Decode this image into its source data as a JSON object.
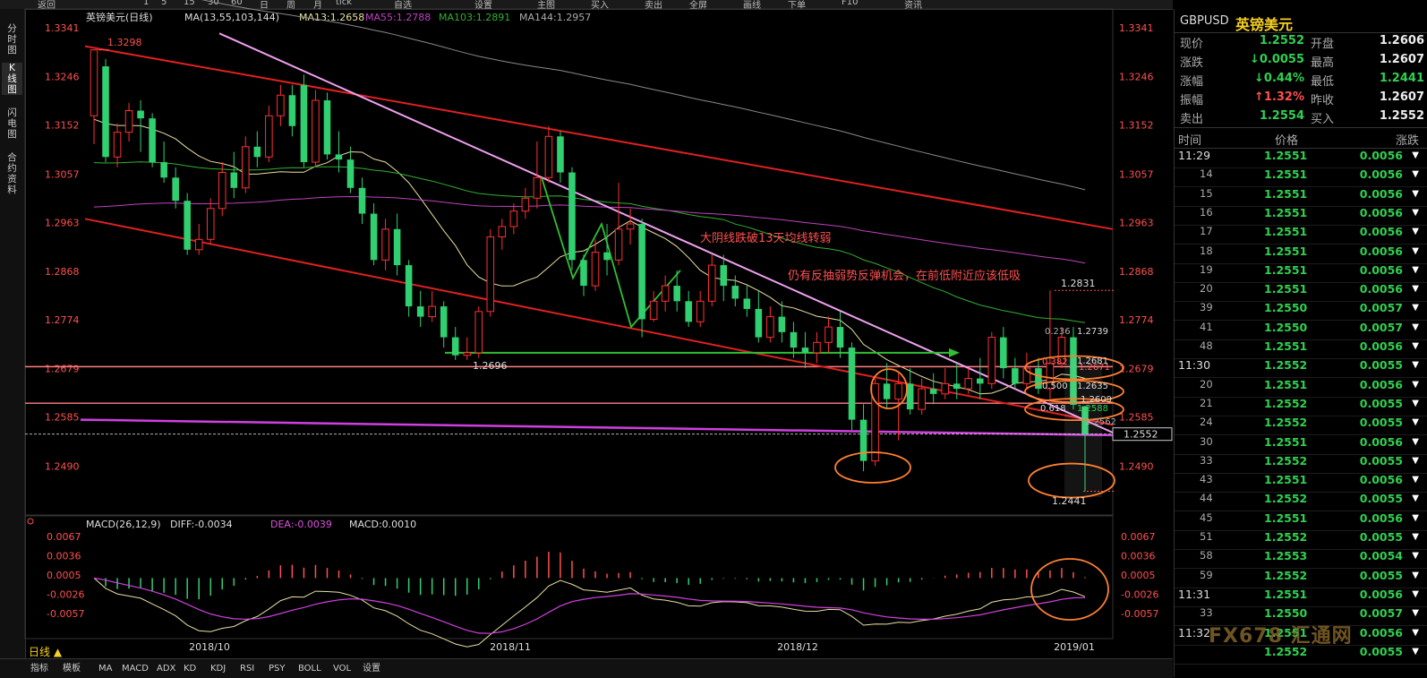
{
  "toolbar": {
    "items": [
      "返回",
      "1",
      "5",
      "15",
      "30",
      "60",
      "日",
      "周",
      "月",
      "tick",
      "自选",
      "设置",
      "主图",
      "买入",
      "卖出",
      "全屏",
      "画线",
      "下单",
      "F10",
      "资讯"
    ]
  },
  "left_rail": {
    "items": [
      "分时图",
      "K线图",
      "闪电图",
      "合约资料"
    ]
  },
  "main_legend": {
    "name": "英镑美元(日线)",
    "ma_params": "MA(13,55,103,144)",
    "ma13": "MA13:1.2658",
    "ma55": "MA55:1.2788",
    "ma103": "MA103:1.2891",
    "ma144": "MA144:1.2957"
  },
  "macd_legend": {
    "params": "MACD(26,12,9)",
    "diff": "DIFF:-0.0034",
    "dea": "DEA:-0.0039",
    "macd": "MACD:0.0010"
  },
  "period_button": "日线 ▲",
  "bottom_tabs": [
    "指标",
    "模板",
    "MA",
    "MACD",
    "ADX",
    "KD",
    "KDJ",
    "RSI",
    "PSY",
    "BOLL",
    "VOL",
    "设置"
  ],
  "watermark": "FX678 汇通网",
  "colors": {
    "up": "#ff3030",
    "down": "#30d070",
    "ma13": "#e8e0a0",
    "ma55": "#30b030",
    "ma103": "#c040c0",
    "ma144": "#888888",
    "annotation": "#ff5050",
    "fib": "#ff8030"
  },
  "quote": {
    "code": "GBPUSD",
    "name": "英镑美元",
    "rows": [
      {
        "l": "现价",
        "v": "1.2552",
        "l2": "开盘",
        "v2": "1.2606"
      },
      {
        "l": "涨跌",
        "v": "↓0.0055",
        "l2": "最高",
        "v2": "1.2607"
      },
      {
        "l": "涨幅",
        "v": "↓0.44%",
        "l2": "最低",
        "v2": "1.2441"
      },
      {
        "l": "振幅",
        "v": "↑1.32%",
        "l2": "昨收",
        "v2": "1.2607"
      },
      {
        "l": "卖出",
        "v": "1.2554",
        "l2": "买入",
        "v2": "1.2552"
      }
    ],
    "tick_header": {
      "time": "时间",
      "price": "价格",
      "change": "涨跌"
    },
    "ticks": [
      {
        "t": "11:29",
        "p": "1.2551",
        "c": "0.0056"
      },
      {
        "t": "14",
        "p": "1.2551",
        "c": "0.0056"
      },
      {
        "t": "15",
        "p": "1.2551",
        "c": "0.0056"
      },
      {
        "t": "16",
        "p": "1.2551",
        "c": "0.0056"
      },
      {
        "t": "17",
        "p": "1.2551",
        "c": "0.0056"
      },
      {
        "t": "18",
        "p": "1.2551",
        "c": "0.0056"
      },
      {
        "t": "19",
        "p": "1.2551",
        "c": "0.0056"
      },
      {
        "t": "20",
        "p": "1.2551",
        "c": "0.0056"
      },
      {
        "t": "39",
        "p": "1.2550",
        "c": "0.0057"
      },
      {
        "t": "41",
        "p": "1.2550",
        "c": "0.0057"
      },
      {
        "t": "48",
        "p": "1.2551",
        "c": "0.0056"
      },
      {
        "t": "11:30",
        "p": "1.2552",
        "c": "0.0055"
      },
      {
        "t": "20",
        "p": "1.2551",
        "c": "0.0056"
      },
      {
        "t": "21",
        "p": "1.2552",
        "c": "0.0055"
      },
      {
        "t": "24",
        "p": "1.2552",
        "c": "0.0055"
      },
      {
        "t": "30",
        "p": "1.2551",
        "c": "0.0056"
      },
      {
        "t": "33",
        "p": "1.2552",
        "c": "0.0055"
      },
      {
        "t": "43",
        "p": "1.2551",
        "c": "0.0056"
      },
      {
        "t": "44",
        "p": "1.2552",
        "c": "0.0055"
      },
      {
        "t": "45",
        "p": "1.2551",
        "c": "0.0056"
      },
      {
        "t": "51",
        "p": "1.2552",
        "c": "0.0055"
      },
      {
        "t": "58",
        "p": "1.2553",
        "c": "0.0054"
      },
      {
        "t": "59",
        "p": "1.2552",
        "c": "0.0055"
      },
      {
        "t": "11:31",
        "p": "1.2551",
        "c": "0.0056"
      },
      {
        "t": "33",
        "p": "1.2550",
        "c": "0.0057"
      },
      {
        "t": "11:32",
        "p": "1.2551",
        "c": "0.0056"
      },
      {
        "t": "",
        "p": "1.2552",
        "c": "0.0055"
      }
    ]
  },
  "chart_data": {
    "type": "candlestick",
    "price_axis_ticks": [
      1.3341,
      1.3246,
      1.3152,
      1.3057,
      1.2963,
      1.2868,
      1.2774,
      1.2679,
      1.2585,
      1.249
    ],
    "ylim": [
      1.2395,
      1.336
    ],
    "macd_axis_ticks": [
      "0.0067",
      "0.0036",
      "0.0005",
      "-0.0026",
      "-0.0057"
    ],
    "macd_ylim": [
      -0.0086,
      0.008
    ],
    "x_labels": [
      "2018/10",
      "2018/11",
      "2018/12",
      "2019/01"
    ],
    "current_price": "1.2552",
    "high_label": "1.3298",
    "low_label_oct": "1.2696",
    "recent_high_label": "1.2831",
    "latest_low_label": "1.2441",
    "fib_labels": [
      "0.236",
      "1.2739",
      "0.382",
      "1.2681",
      "1.2671",
      "0.500",
      "1.2635",
      "0.618",
      "1.2588",
      "1.2609",
      "1.2562"
    ],
    "annotations": [
      "大阴线跌破13天均线转弱",
      "仍有反抽弱势反弹机会，在前低附近应该低吸"
    ],
    "candles": [
      [
        1.317,
        1.3298,
        1.3195,
        1.3115
      ],
      [
        1.3266,
        1.309,
        1.328,
        1.308
      ],
      [
        1.309,
        1.3138,
        1.3155,
        1.307
      ],
      [
        1.3138,
        1.318,
        1.3195,
        1.312
      ],
      [
        1.318,
        1.3165,
        1.32,
        1.31
      ],
      [
        1.3165,
        1.308,
        1.3175,
        1.307
      ],
      [
        1.308,
        1.305,
        1.312,
        1.304
      ],
      [
        1.305,
        1.3005,
        1.307,
        1.299
      ],
      [
        1.3005,
        1.291,
        1.302,
        1.29
      ],
      [
        1.291,
        1.293,
        1.296,
        1.29
      ],
      [
        1.293,
        1.299,
        1.301,
        1.292
      ],
      [
        1.299,
        1.306,
        1.308,
        1.2975
      ],
      [
        1.306,
        1.303,
        1.31,
        1.301
      ],
      [
        1.303,
        1.311,
        1.313,
        1.302
      ],
      [
        1.311,
        1.309,
        1.314,
        1.307
      ],
      [
        1.309,
        1.317,
        1.319,
        1.308
      ],
      [
        1.317,
        1.321,
        1.323,
        1.315
      ],
      [
        1.321,
        1.315,
        1.323,
        1.313
      ],
      [
        1.323,
        1.308,
        1.325,
        1.307
      ],
      [
        1.308,
        1.32,
        1.322,
        1.307
      ],
      [
        1.32,
        1.3095,
        1.3215,
        1.3085
      ],
      [
        1.3095,
        1.3085,
        1.314,
        1.306
      ],
      [
        1.3085,
        1.303,
        1.311,
        1.302
      ],
      [
        1.303,
        1.298,
        1.305,
        1.296
      ],
      [
        1.298,
        1.289,
        1.3,
        1.288
      ],
      [
        1.289,
        1.295,
        1.297,
        1.287
      ],
      [
        1.295,
        1.288,
        1.298,
        1.286
      ],
      [
        1.288,
        1.28,
        1.289,
        1.278
      ],
      [
        1.28,
        1.278,
        1.283,
        1.276
      ],
      [
        1.278,
        1.28,
        1.283,
        1.277
      ],
      [
        1.28,
        1.274,
        1.281,
        1.272
      ],
      [
        1.274,
        1.2705,
        1.276,
        1.2696
      ],
      [
        1.2705,
        1.271,
        1.274,
        1.2696
      ],
      [
        1.271,
        1.279,
        1.28,
        1.27
      ],
      [
        1.279,
        1.2935,
        1.295,
        1.278
      ],
      [
        1.2935,
        1.2955,
        1.297,
        1.291
      ],
      [
        1.2955,
        1.2985,
        1.3,
        1.294
      ],
      [
        1.2985,
        1.301,
        1.303,
        1.297
      ],
      [
        1.301,
        1.305,
        1.312,
        1.299
      ],
      [
        1.305,
        1.313,
        1.315,
        1.304
      ],
      [
        1.313,
        1.306,
        1.314,
        1.304
      ],
      [
        1.306,
        1.289,
        1.307,
        1.287
      ],
      [
        1.289,
        1.284,
        1.29,
        1.282
      ],
      [
        1.284,
        1.2905,
        1.293,
        1.283
      ],
      [
        1.2905,
        1.289,
        1.296,
        1.286
      ],
      [
        1.289,
        1.295,
        1.304,
        1.288
      ],
      [
        1.295,
        1.296,
        1.299,
        1.292
      ],
      [
        1.296,
        1.2775,
        1.297,
        1.274
      ],
      [
        1.2775,
        1.281,
        1.283,
        1.277
      ],
      [
        1.281,
        1.284,
        1.286,
        1.279
      ],
      [
        1.284,
        1.281,
        1.287,
        1.279
      ],
      [
        1.281,
        1.277,
        1.283,
        1.276
      ],
      [
        1.277,
        1.281,
        1.283,
        1.276
      ],
      [
        1.281,
        1.288,
        1.29,
        1.28
      ],
      [
        1.288,
        1.284,
        1.29,
        1.281
      ],
      [
        1.284,
        1.2815,
        1.286,
        1.28
      ],
      [
        1.2815,
        1.2795,
        1.284,
        1.278
      ],
      [
        1.2795,
        1.274,
        1.283,
        1.273
      ],
      [
        1.274,
        1.278,
        1.28,
        1.273
      ],
      [
        1.278,
        1.275,
        1.281,
        1.273
      ],
      [
        1.275,
        1.272,
        1.277,
        1.27
      ],
      [
        1.272,
        1.271,
        1.275,
        1.268
      ],
      [
        1.271,
        1.273,
        1.275,
        1.269
      ],
      [
        1.273,
        1.276,
        1.278,
        1.271
      ],
      [
        1.276,
        1.272,
        1.279,
        1.27
      ],
      [
        1.272,
        1.258,
        1.273,
        1.256
      ],
      [
        1.258,
        1.25,
        1.261,
        1.248
      ],
      [
        1.25,
        1.265,
        1.266,
        1.249
      ],
      [
        1.265,
        1.262,
        1.269,
        1.26
      ],
      [
        1.262,
        1.265,
        1.267,
        1.254
      ],
      [
        1.265,
        1.26,
        1.268,
        1.259
      ],
      [
        1.26,
        1.264,
        1.266,
        1.259
      ],
      [
        1.264,
        1.263,
        1.267,
        1.261
      ],
      [
        1.263,
        1.265,
        1.268,
        1.262
      ],
      [
        1.265,
        1.264,
        1.269,
        1.262
      ],
      [
        1.264,
        1.266,
        1.268,
        1.263
      ],
      [
        1.266,
        1.265,
        1.27,
        1.262
      ],
      [
        1.265,
        1.274,
        1.275,
        1.264
      ],
      [
        1.274,
        1.268,
        1.276,
        1.266
      ],
      [
        1.268,
        1.265,
        1.27,
        1.264
      ],
      [
        1.265,
        1.268,
        1.271,
        1.264
      ],
      [
        1.268,
        1.264,
        1.27,
        1.263
      ],
      [
        1.264,
        1.269,
        1.2831,
        1.262
      ],
      [
        1.269,
        1.274,
        1.276,
        1.268
      ],
      [
        1.274,
        1.2609,
        1.276,
        1.26
      ],
      [
        1.2606,
        1.2552,
        1.2607,
        1.2441
      ]
    ]
  }
}
